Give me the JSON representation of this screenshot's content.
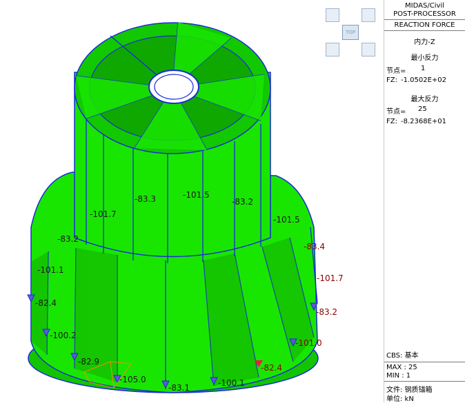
{
  "panel": {
    "app_line1": "MIDAS/Civil",
    "app_line2": "POST-PROCESSOR",
    "result_type": "REACTION FORCE",
    "component": "内力-Z",
    "min_title": "最小反力",
    "min_node_label": "节点=",
    "min_node_value": "1",
    "min_fz_label": "FZ:",
    "min_fz_value": "-1.0502E+02",
    "max_title": "最大反力",
    "max_node_label": "节点=",
    "max_node_value": "25",
    "max_fz_label": "FZ:",
    "max_fz_value": "-8.2368E+01",
    "cbs": "CBS: 基本",
    "max_line": "MAX : 25",
    "min_line": "MIN : 1",
    "file_line": "文件: 钢质锚箱",
    "unit_line": "单位: kN"
  },
  "view_cube": {
    "top_label": "TOP"
  },
  "labels": {
    "l1": "-83.3",
    "l2": "-101.5",
    "l3": "-83.2",
    "l4": "-101.7",
    "l5": "-101.5",
    "l6": "-83.2",
    "l7": "-83.4",
    "l8": "-101.1",
    "l9": "-101.7",
    "l10": "-82.4",
    "l11": "-83.2",
    "l12": "-100.2",
    "l13": "-101.0",
    "l14": "-82.9",
    "l15": "-82.4",
    "l16": "-105.0",
    "l17": "-83.1",
    "l18": "-100.1"
  },
  "colors": {
    "model_fill": "#19e600",
    "model_shade": "#12b800",
    "edge": "#1a2bd6",
    "highlight_max": "#e8203a",
    "highlight_min": "#ff8a00"
  }
}
